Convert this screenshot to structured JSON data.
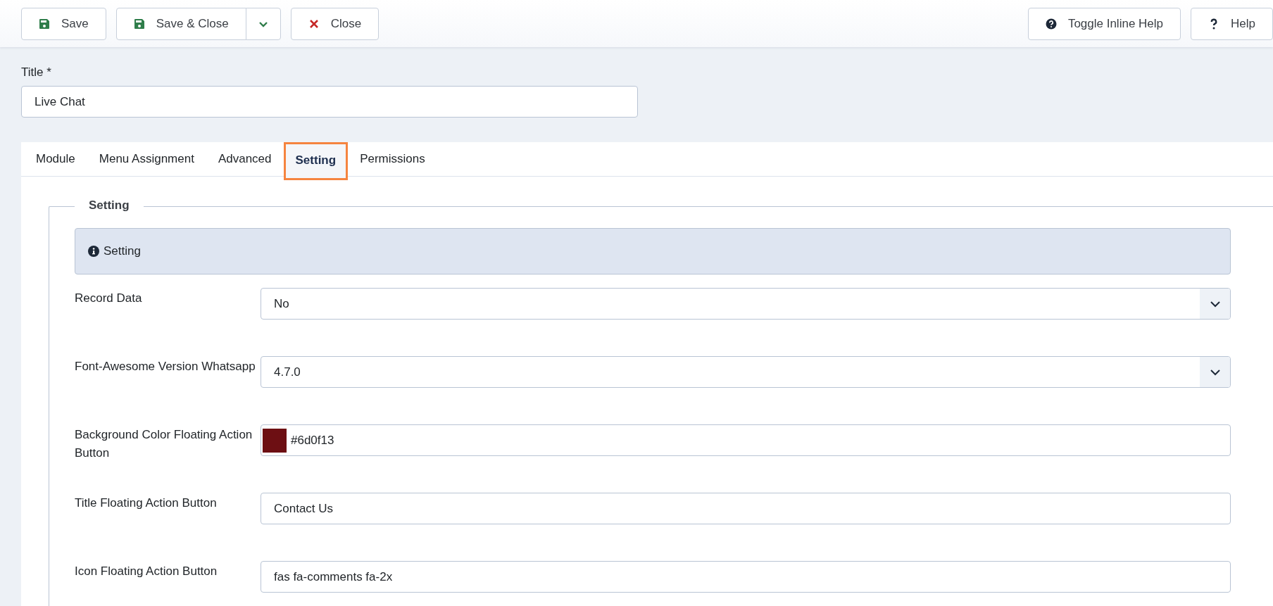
{
  "toolbar": {
    "left": [
      {
        "kind": "save",
        "label": "Save"
      },
      {
        "kind": "save-close",
        "label": "Save & Close"
      },
      {
        "kind": "close",
        "label": "Close"
      }
    ],
    "right": [
      {
        "kind": "toggle-help",
        "label": "Toggle Inline Help"
      },
      {
        "kind": "help",
        "label": "Help"
      }
    ]
  },
  "title_field": {
    "label": "Title *",
    "value": "Live Chat"
  },
  "tabs": [
    {
      "label": "Module",
      "selected": false
    },
    {
      "label": "Menu Assignment",
      "selected": false
    },
    {
      "label": "Advanced",
      "selected": false
    },
    {
      "label": "Setting",
      "selected": true
    },
    {
      "label": "Permissions",
      "selected": false
    }
  ],
  "fieldset": {
    "legend": "Setting",
    "info": "Setting",
    "fields": [
      {
        "kind": "select",
        "label": "Record Data",
        "value": "No"
      },
      {
        "kind": "select",
        "label": "Font-Awesome Version Whatsapp",
        "value": "4.7.0"
      },
      {
        "kind": "color",
        "label": "Background Color Floating Action Button",
        "value": "#6d0f13",
        "color": "#6d0f13"
      },
      {
        "kind": "text",
        "label": "Title Floating Action Button",
        "value": "Contact Us"
      },
      {
        "kind": "text",
        "label": "Icon Floating Action Button",
        "value": "fas fa-comments fa-2x"
      }
    ]
  }
}
